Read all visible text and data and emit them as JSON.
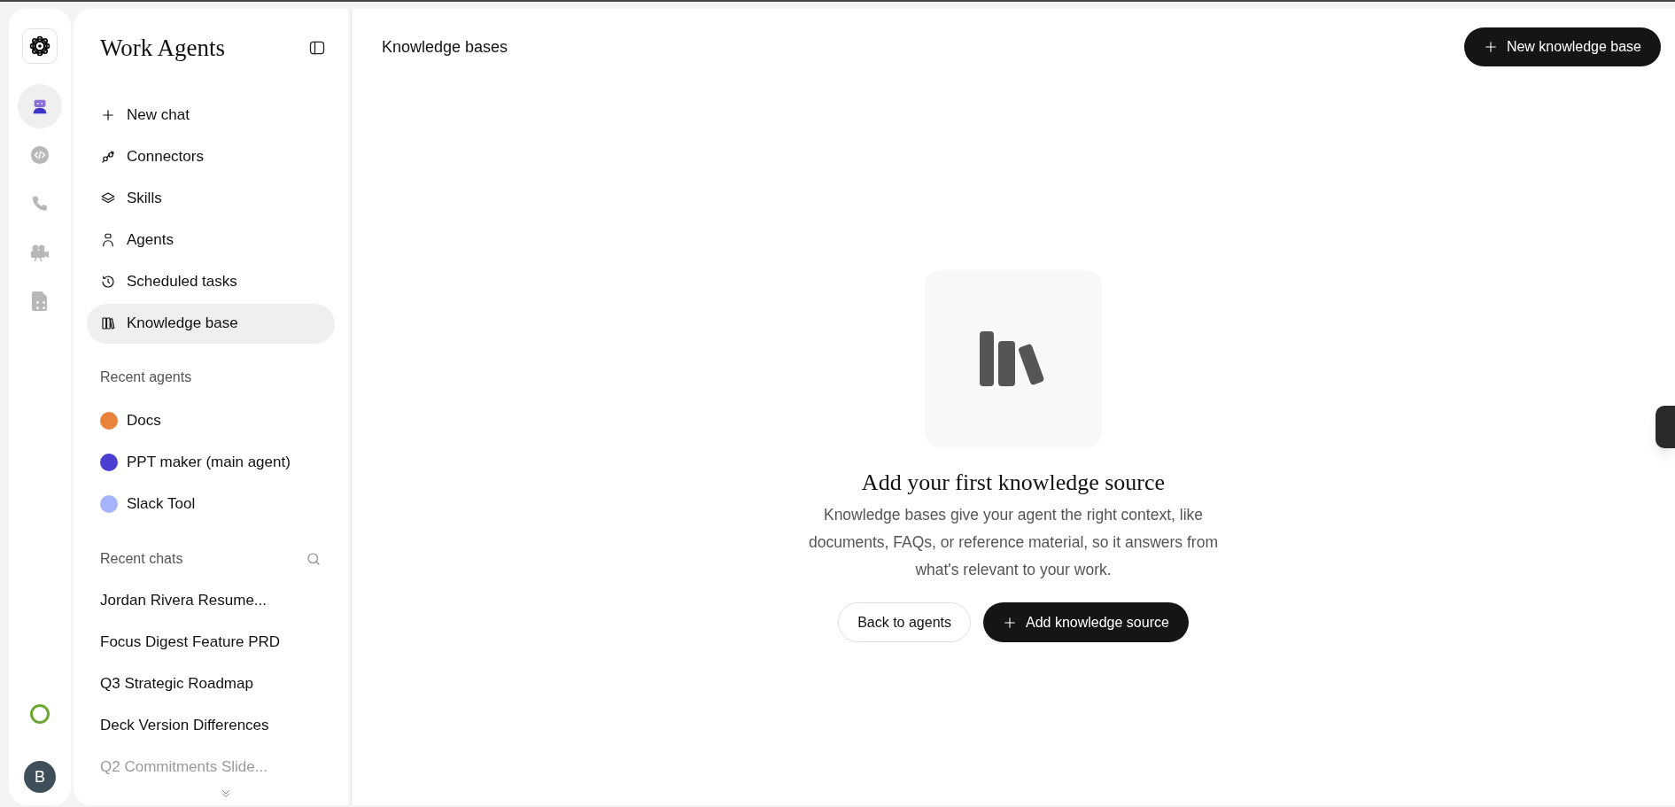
{
  "app": {
    "title": "Work Agents"
  },
  "rail": {
    "items": [
      {
        "kind": "robot",
        "selected": true
      },
      {
        "kind": "code",
        "selected": false
      },
      {
        "kind": "phone",
        "selected": false
      },
      {
        "kind": "camera",
        "selected": false
      },
      {
        "kind": "file",
        "selected": false
      }
    ],
    "avatar": "B"
  },
  "nav": [
    {
      "kind": "plus",
      "label": "New chat",
      "selected": false
    },
    {
      "kind": "connectors",
      "label": "Connectors",
      "selected": false
    },
    {
      "kind": "skills",
      "label": "Skills",
      "selected": false
    },
    {
      "kind": "agents",
      "label": "Agents",
      "selected": false
    },
    {
      "kind": "clock",
      "label": "Scheduled tasks",
      "selected": false
    },
    {
      "kind": "books",
      "label": "Knowledge base",
      "selected": true
    }
  ],
  "recent_agents": {
    "heading": "Recent agents",
    "items": [
      {
        "label": "Docs",
        "color": "#e9823a"
      },
      {
        "label": "PPT maker (main agent)",
        "color": "#4a3fd0"
      },
      {
        "label": "Slack Tool",
        "color": "#a5b4fc"
      }
    ]
  },
  "recent_chats": {
    "heading": "Recent chats",
    "items": [
      "Jordan Rivera Resume...",
      "Focus Digest Feature PRD",
      "Q3 Strategic Roadmap",
      "Deck Version Differences",
      "Q2 Commitments Slide..."
    ]
  },
  "main": {
    "title": "Knowledge bases",
    "new_button": "New knowledge base",
    "empty_state": {
      "heading": "Add your first knowledge source",
      "description": "Knowledge bases give your agent the right context, like documents, FAQs, or reference material, so it answers from what's relevant to your work.",
      "secondary_button": "Back to agents",
      "primary_button": "Add knowledge source"
    }
  }
}
